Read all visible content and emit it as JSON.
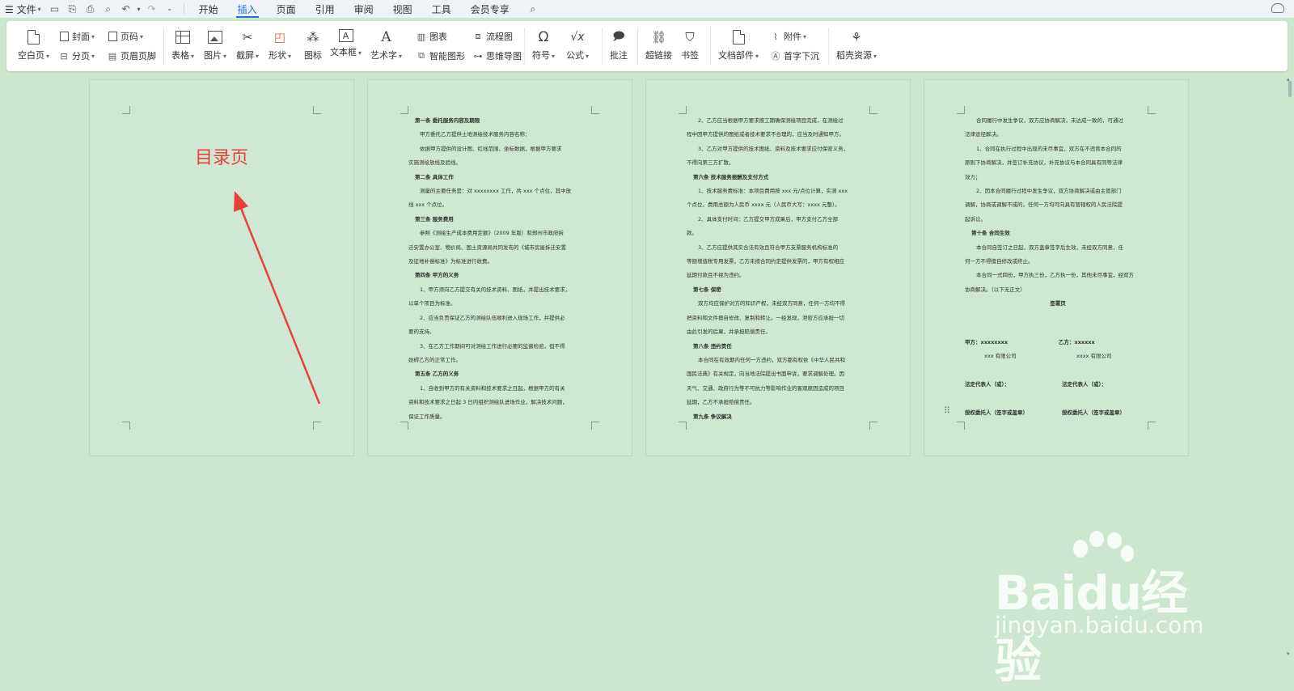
{
  "menubar": {
    "file_label": "☰ 文件",
    "tabs": [
      "开始",
      "插入",
      "页面",
      "引用",
      "审阅",
      "视图",
      "工具",
      "会员专享"
    ],
    "active_tab": "插入"
  },
  "ribbon": {
    "blank_page": "空白页",
    "cover": "封面",
    "page_break": "分页",
    "page_number": "页码",
    "header_footer": "页眉页脚",
    "table": "表格",
    "picture": "图片",
    "screenshot": "截屏",
    "shape": "形状",
    "icon": "图标",
    "textbox": "文本框",
    "wordart": "艺术字",
    "chart": "图表",
    "smart_shape": "智能图形",
    "flowchart": "流程图",
    "mindmap": "思维导图",
    "symbol": "符号",
    "formula": "公式",
    "comment": "批注",
    "hyperlink": "超链接",
    "bookmark": "书签",
    "attachment": "附件",
    "doc_parts": "文档部件",
    "drop_cap": "首字下沉",
    "resources": "稻壳资源"
  },
  "pages": {
    "page1": {
      "title": "目录页"
    },
    "page2": {
      "lines": [
        {
          "t": "第一条  委托服务内容及期限",
          "k": "h"
        },
        {
          "t": "甲方委托乙方提供土地测绘技术服务内容名称：",
          "k": "ind"
        },
        {
          "t": "依据甲方提供的设计图、红线范围、坐标数据，根据甲方要求",
          "k": "ind"
        },
        {
          "t": "实施测绘放线及验线。",
          "k": "p"
        },
        {
          "t": "第二条  具体工作",
          "k": "h"
        },
        {
          "t": "测量的主要任务是：对 xxxxxxxx 工作，共 xxx 个点位，其中放",
          "k": "ind"
        },
        {
          "t": "线 xxx 个点位。",
          "k": "p"
        },
        {
          "t": "第三条  服务费用",
          "k": "h"
        },
        {
          "t": "参照《测绘生产成本费用定额》（2009 年版）和郑州市政府拆",
          "k": "ind"
        },
        {
          "t": "迁安置办公室、物价局、国土资源局共同发布的《城市房屋拆迁安置",
          "k": "p"
        },
        {
          "t": "及征地补偿标准》为标准进行收费。",
          "k": "p"
        },
        {
          "t": "第四条  甲方的义务",
          "k": "h"
        },
        {
          "t": "1、甲方须向乙方提交有关的技术资料、图纸，并提出技术要求，",
          "k": "ind"
        },
        {
          "t": "以单个项目为标准。",
          "k": "p"
        },
        {
          "t": "2、应当负责保证乙方的测绘队伍顺利进入现场工作，并提供必",
          "k": "ind"
        },
        {
          "t": "要的支持。",
          "k": "p"
        },
        {
          "t": "3、在乙方工作期间可对测绘工作进行必要的监督检验，但不得",
          "k": "ind"
        },
        {
          "t": "妨碍乙方的正常工作。",
          "k": "p"
        },
        {
          "t": "第五条  乙方的义务",
          "k": "h"
        },
        {
          "t": "1、自收到甲方的有关资料和技术要求之日起，根据甲方的有关",
          "k": "ind"
        },
        {
          "t": "资料和技术要求之日起 3 日内组织测绘队进场作业，解决技术问题，",
          "k": "p"
        },
        {
          "t": "保证工作质量。",
          "k": "p"
        }
      ]
    },
    "page3": {
      "lines": [
        {
          "t": "2、乙方应当根据甲方要求按工期确保测绘项目完成，在测绘过",
          "k": "ind"
        },
        {
          "t": "程中因甲方提供的图纸或者技术要求不合理的，应当及时通知甲方。",
          "k": "p"
        },
        {
          "t": "3、乙方对甲方提供的技术图纸、资料及技术要求应付保密义务，",
          "k": "ind"
        },
        {
          "t": "不得向第三方扩散。",
          "k": "p"
        },
        {
          "t": "第六条  技术服务报酬及支付方式",
          "k": "h"
        },
        {
          "t": "1、技术服务费标准：本项目费用按 xxx 元/点位计算，实测 xxx",
          "k": "ind"
        },
        {
          "t": "个点位，费用总额为人民币 xxxx 元（人民币大写：xxxx 元整）。",
          "k": "p"
        },
        {
          "t": "2、具体支付时间：乙方提交甲方成果后，甲方支付乙方全部",
          "k": "ind"
        },
        {
          "t": "款。",
          "k": "p"
        },
        {
          "t": "3、乙方应提供其实合法有效且符合甲方支票服务机构标准的",
          "k": "ind"
        },
        {
          "t": "等额增值税专用发票，乙方未按合同约定提供发票的，甲方有权相应",
          "k": "p"
        },
        {
          "t": "延期付款且不视为违约。",
          "k": "p"
        },
        {
          "t": "第七条  保密",
          "k": "h"
        },
        {
          "t": "双方均应保护对方的知识产权，未经双方同意，任何一方均不得",
          "k": "ind"
        },
        {
          "t": "把资料和文件擅自修改、复制和转让。一经发现，泄密方应承担一切",
          "k": "p"
        },
        {
          "t": "由此引发的后果，并承担赔偿责任。",
          "k": "p"
        },
        {
          "t": "第八条  违约责任",
          "k": "h"
        },
        {
          "t": "本合同在有效期内任何一方违约，双方都有权依《中华人民共和",
          "k": "ind"
        },
        {
          "t": "国民法典》有关规定，向当地法院提出书面申诉，要求调解处理。因",
          "k": "p"
        },
        {
          "t": "天气、交通、政府行为等不可抗力等影响作业的客观原因造成的项目",
          "k": "p"
        },
        {
          "t": "延期，乙方不承担赔偿责任。",
          "k": "p"
        },
        {
          "t": "第九条  争议解决",
          "k": "h"
        }
      ]
    },
    "page4": {
      "lines": [
        {
          "t": "合同履行中发生争议，双方应协商解决，未达成一致的，可通过",
          "k": "ind"
        },
        {
          "t": "法律途径解决。",
          "k": "p"
        },
        {
          "t": "1、合同在执行过程中出现的未尽事宜，双方在不违背本合同的",
          "k": "ind"
        },
        {
          "t": "原则下协商解决，并签订补充协议，补充协议与本合同具有同等法律",
          "k": "p"
        },
        {
          "t": "效力；",
          "k": "p"
        },
        {
          "t": "2、因本合同履行过程中发生争议，双方协商解决或由主管部门",
          "k": "ind"
        },
        {
          "t": "调解，协商或调解不成的，任何一方均可向具有管辖权的人民法院提",
          "k": "p"
        },
        {
          "t": "起诉讼。",
          "k": "p"
        },
        {
          "t": "第十条  合同生效",
          "k": "h"
        },
        {
          "t": "本合同自签订之日起，双方盖章签字后生效，未经双方同意，任",
          "k": "ind"
        },
        {
          "t": "何一方不得擅自修改或终止。",
          "k": "p"
        },
        {
          "t": "本合同一式四份，甲方执三份，乙方执一份，其他未尽事宜，经双方",
          "k": "ind"
        },
        {
          "t": "协商解决。（以下无正文）",
          "k": "p"
        },
        {
          "t": "签署页",
          "k": "c"
        }
      ],
      "party_a_label": "甲方：xxxxxxxx",
      "party_a_company": "xxx 有限公司",
      "party_b_label": "乙方：xxxxxx",
      "party_b_company": "xxxx 有限公司",
      "legal_rep_a": "法定代表人（或）：",
      "legal_rep_b": "法定代表人（或）：",
      "agent_a": "授权委托人（签字或盖章）",
      "agent_b": "授权委托人（签字或盖章）"
    }
  },
  "watermark": {
    "brand": "Baidu经验",
    "url": "jingyan.baidu.com"
  },
  "colors": {
    "page_bg": "#cde6cf",
    "accent": "#1f6fde",
    "toc_red": "#e8403a"
  }
}
